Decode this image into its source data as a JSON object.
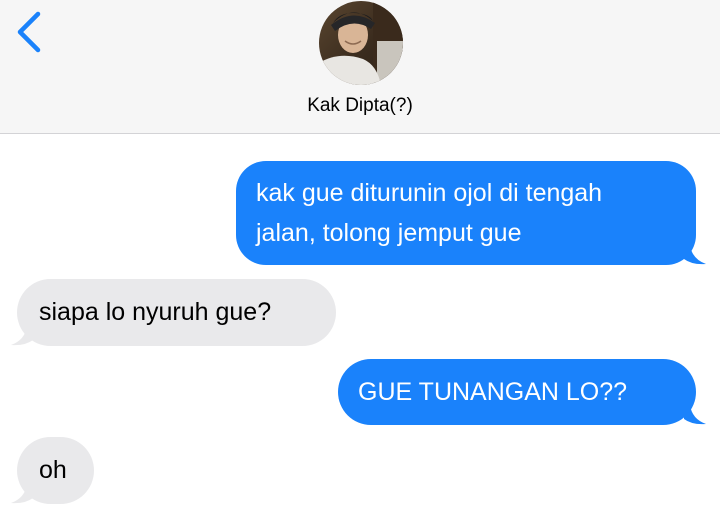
{
  "header": {
    "contact_name": "Kak Dipta(?)",
    "back_icon": "chevron-left-icon",
    "accent_color": "#1a82fb"
  },
  "messages": [
    {
      "direction": "outgoing",
      "lines": [
        "kak gue diturunin ojol di tengah",
        "jalan, tolong jemput gue"
      ]
    },
    {
      "direction": "incoming",
      "text": "siapa lo nyuruh gue?"
    },
    {
      "direction": "outgoing",
      "text": "GUE TUNANGAN LO??"
    },
    {
      "direction": "incoming",
      "text": "oh"
    }
  ],
  "colors": {
    "outgoing_bubble": "#1a82fb",
    "incoming_bubble": "#e9e9eb",
    "header_bg": "#f6f6f6"
  }
}
